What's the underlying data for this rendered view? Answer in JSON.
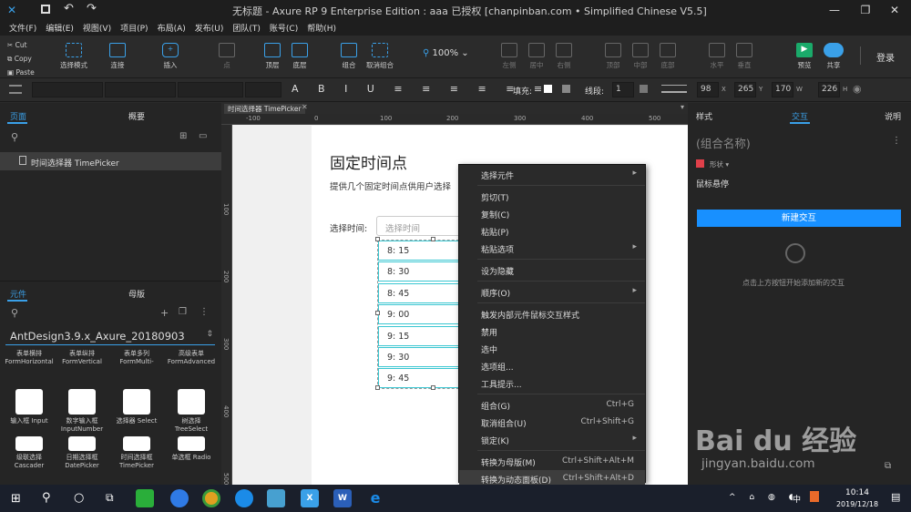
{
  "window": {
    "title": "无标题 - Axure RP 9 Enterprise Edition : aaa 已授权    [chanpinban.com • Simplified Chinese V5.5]",
    "minimize": "—",
    "maximize": "❐",
    "close": "✕"
  },
  "menubar": [
    "文件(F)",
    "编辑(E)",
    "视图(V)",
    "项目(P)",
    "布局(A)",
    "发布(U)",
    "团队(T)",
    "账号(C)",
    "帮助(H)"
  ],
  "toolbar": {
    "clipboard": [
      "Cut",
      "Copy",
      "Paste"
    ],
    "select_mode": "选择模式",
    "connect": "连接",
    "insert": "插入",
    "point": "点",
    "top_layer": "顶层",
    "bottom_layer": "底层",
    "group": "组合",
    "ungroup": "取消组合",
    "zoom": "100%",
    "align_left": "左侧",
    "align_center": "居中",
    "align_right": "右侧",
    "align_top": "顶部",
    "align_middle": "中部",
    "align_bottom": "底部",
    "horizontal": "水平",
    "vertical": "垂直",
    "preview": "预览",
    "share": "共享",
    "login": "登录"
  },
  "stylebar": {
    "fill_label": "填充:",
    "line_label": "线段:",
    "line_value": "1",
    "x": "98",
    "x_label": "X",
    "y": "265",
    "y_label": "Y",
    "w": "170",
    "w_label": "W",
    "h": "226",
    "h_label": "H"
  },
  "left_panel": {
    "tabs": [
      "页面",
      "概要"
    ],
    "page_item": "时间选择器 TimePicker",
    "lib_tabs": [
      "元件",
      "母版"
    ],
    "library_name": "AntDesign3.9.x_Axure_20180903",
    "widgets_row1": [
      {
        "cn": "表单横排",
        "en": "FormHorizontal"
      },
      {
        "cn": "表单纵排",
        "en": "FormVertical"
      },
      {
        "cn": "表单多列",
        "en": "FormMulti-"
      },
      {
        "cn": "高级表单",
        "en": "FormAdvanced"
      }
    ],
    "widgets_row2": [
      {
        "cn": "输入框 Input",
        "en": ""
      },
      {
        "cn": "数字输入框",
        "en": "InputNumber"
      },
      {
        "cn": "选择器 Select",
        "en": ""
      },
      {
        "cn": "树选择",
        "en": "TreeSelect"
      }
    ],
    "widgets_row3": [
      {
        "cn": "级联选择",
        "en": "Cascader"
      },
      {
        "cn": "日期选择框",
        "en": "DatePicker"
      },
      {
        "cn": "时间选择框",
        "en": "TimePicker"
      },
      {
        "cn": "单选框 Radio",
        "en": ""
      }
    ]
  },
  "canvas": {
    "tab_label": "时间选择器 TimePicker",
    "ruler_marks": [
      "-100",
      "0",
      "100",
      "200",
      "300",
      "400",
      "500"
    ],
    "vruler_marks": [
      "100",
      "200",
      "300",
      "400",
      "500"
    ],
    "heading": "固定时间点",
    "description": "提供几个固定时间点供用户选择",
    "select_label": "选择时间:",
    "placeholder": "选择时间",
    "times": [
      "8: 15",
      "8: 30",
      "8: 45",
      "9: 00",
      "9: 15",
      "9: 30",
      "9: 45"
    ]
  },
  "context_menu": [
    {
      "label": "选择元件",
      "shortcut": "",
      "submenu": true
    },
    {
      "sep": true
    },
    {
      "label": "剪切(T)",
      "shortcut": ""
    },
    {
      "label": "复制(C)",
      "shortcut": ""
    },
    {
      "label": "粘贴(P)",
      "shortcut": ""
    },
    {
      "label": "粘贴选项",
      "shortcut": "",
      "submenu": true
    },
    {
      "sep": true
    },
    {
      "label": "设为隐藏",
      "shortcut": ""
    },
    {
      "sep": true
    },
    {
      "label": "顺序(O)",
      "shortcut": "",
      "submenu": true
    },
    {
      "sep": true
    },
    {
      "label": "触发内部元件鼠标交互样式",
      "shortcut": ""
    },
    {
      "label": "禁用",
      "shortcut": ""
    },
    {
      "label": "选中",
      "shortcut": ""
    },
    {
      "label": "选项组...",
      "shortcut": ""
    },
    {
      "label": "工具提示...",
      "shortcut": ""
    },
    {
      "sep": true
    },
    {
      "label": "组合(G)",
      "shortcut": "Ctrl+G"
    },
    {
      "label": "取消组合(U)",
      "shortcut": "Ctrl+Shift+G"
    },
    {
      "label": "锁定(K)",
      "shortcut": "",
      "submenu": true
    },
    {
      "sep": true
    },
    {
      "label": "转换为母版(M)",
      "shortcut": "Ctrl+Shift+Alt+M"
    },
    {
      "label": "转换为动态面板(D)",
      "shortcut": "Ctrl+Shift+Alt+D",
      "highlighted": true
    }
  ],
  "right_panel": {
    "tabs": [
      "样式",
      "交互",
      "说明"
    ],
    "group_name": "(组合名称)",
    "shape_label": "形状 ▾",
    "mouse_hover": "鼠标悬停",
    "new_interaction": "新建交互",
    "hint": "点击上方按钮开始添加新的交互"
  },
  "taskbar": {
    "time": "10:14",
    "date": "2019/12/18",
    "ime": "中"
  },
  "watermark": {
    "brand": "Bai du 经验",
    "url": "jingyan.baidu.com"
  },
  "colors": {
    "accent": "#1890ff",
    "selection": "#39c6d1",
    "highlight": "#3d3d3d"
  }
}
